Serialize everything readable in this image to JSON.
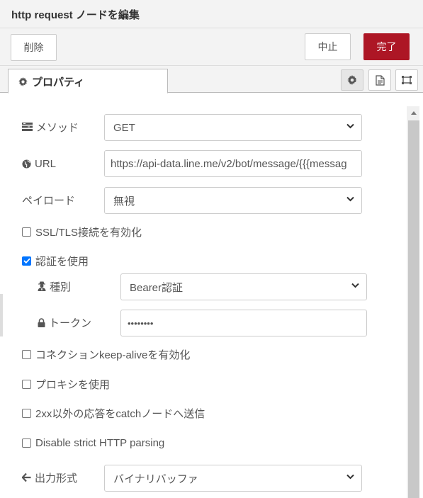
{
  "dialog": {
    "title": "http request ノードを編集"
  },
  "toolbar": {
    "delete_label": "削除",
    "cancel_label": "中止",
    "done_label": "完了"
  },
  "tabs": {
    "properties_label": "プロパティ"
  },
  "form": {
    "method": {
      "label": "メソッド",
      "value": "GET"
    },
    "url": {
      "label": "URL",
      "value": "https://api-data.line.me/v2/bot/message/{{{messag"
    },
    "payload": {
      "label": "ペイロード",
      "value": "無視"
    },
    "ssl": {
      "label": "SSL/TLS接続を有効化",
      "checked": false
    },
    "auth": {
      "label": "認証を使用",
      "checked": true,
      "type_label": "種別",
      "type_value": "Bearer認証",
      "token_label": "トークン",
      "token_value": "••••••••"
    },
    "keepalive": {
      "label": "コネクションkeep-aliveを有効化",
      "checked": false
    },
    "proxy": {
      "label": "プロキシを使用",
      "checked": false
    },
    "catch2xx": {
      "label": "2xx以外の応答をcatchノードへ送信",
      "checked": false
    },
    "strict": {
      "label": "Disable strict HTTP parsing",
      "checked": false
    },
    "output": {
      "label": "出力形式",
      "value": "バイナリバッファ"
    }
  },
  "colors": {
    "primary": "#ad1625",
    "checkbox_checked": "#0075ff"
  }
}
